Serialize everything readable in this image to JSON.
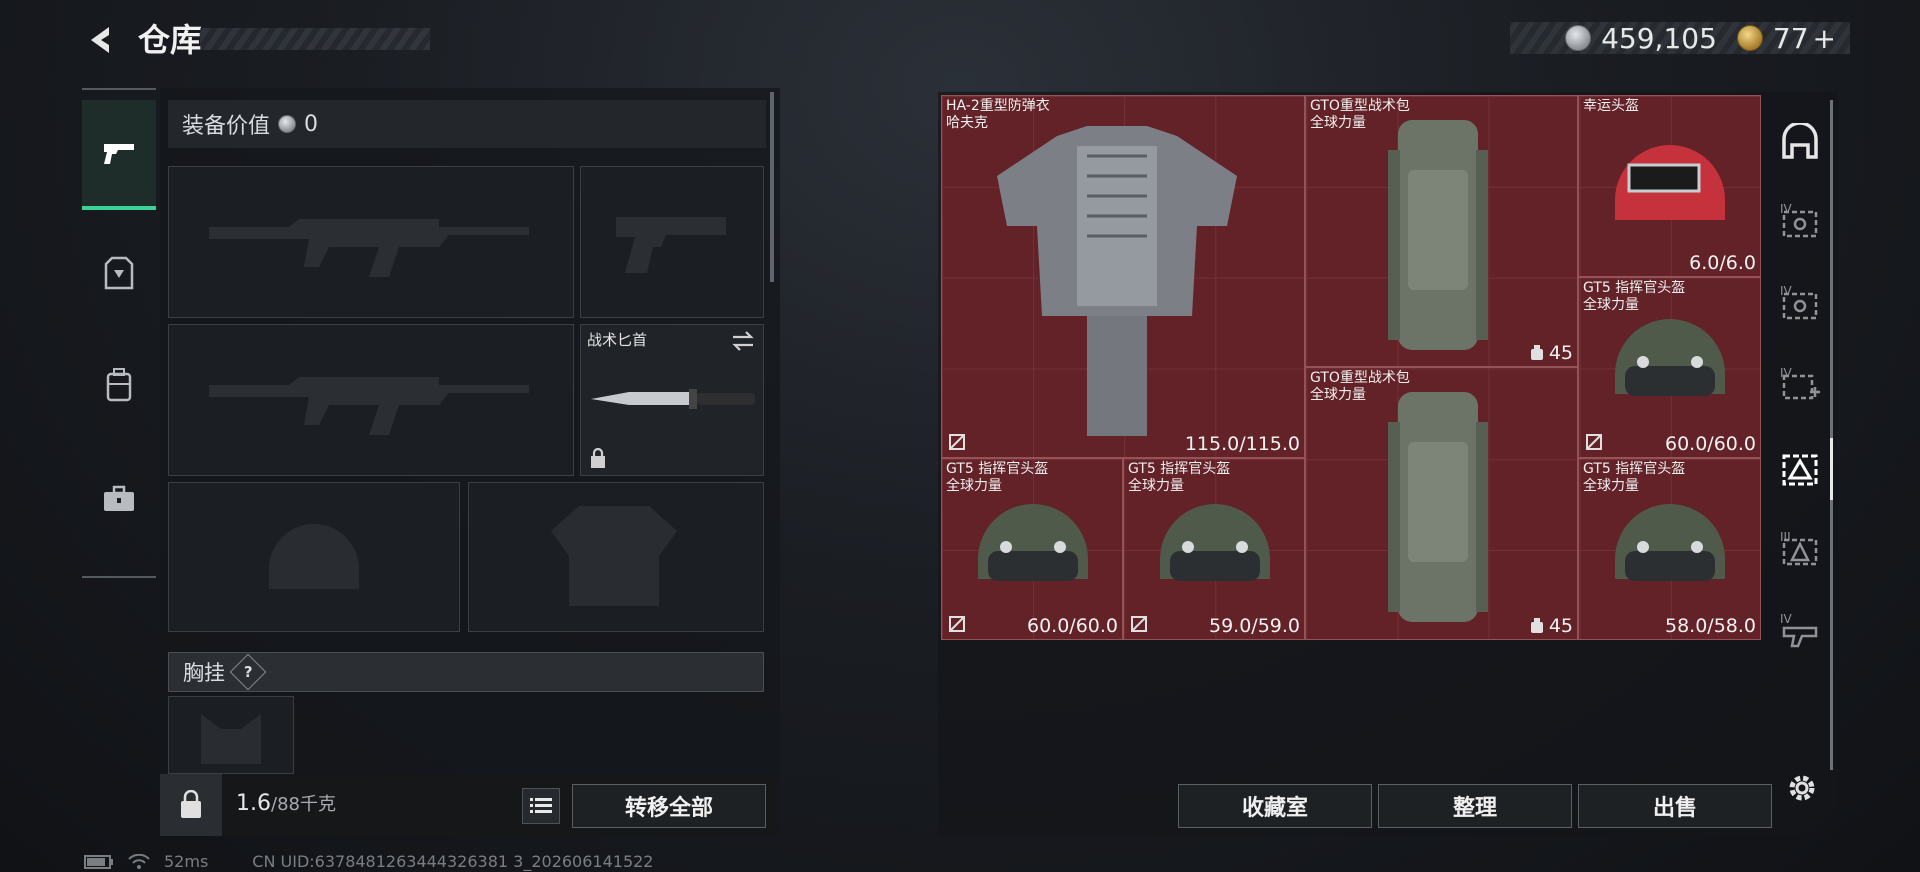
{
  "header": {
    "title": "仓库",
    "back_icon": "back-arrow-icon"
  },
  "currency": {
    "silver_amount": "459,105",
    "gold_amount": "77",
    "gold_plus": "+"
  },
  "rail": {
    "items": [
      "pistol-icon",
      "vest-icon",
      "backpack-icon",
      "case-icon"
    ],
    "active_index": 0
  },
  "loadout": {
    "equipment_value_label": "装备价值",
    "equipment_value": "0",
    "slots": {
      "knife_label": "战术匕首"
    },
    "chest_rig_label": "胸挂",
    "help_label": "?",
    "weight_current": "1.6",
    "weight_capacity": "/88千克",
    "transfer_all": "转移全部"
  },
  "storage": {
    "items": [
      {
        "name": "HA-2重型防弹衣",
        "sub": "哈夫克",
        "durability": "115.0/115.0",
        "insured_icon": true
      },
      {
        "name": "GTO重型战术包",
        "sub": "全球力量",
        "capacity": "45"
      },
      {
        "name": "幸运头盔",
        "sub": "",
        "durability": "6.0/6.0"
      },
      {
        "name": "GT5 指挥官头盔",
        "sub": "全球力量",
        "durability": "60.0/60.0",
        "insured_icon": true
      },
      {
        "name": "GTO重型战术包",
        "sub": "全球力量",
        "capacity": "45"
      },
      {
        "name": "GT5 指挥官头盔",
        "sub": "全球力量",
        "durability": "60.0/60.0",
        "insured_icon": true
      },
      {
        "name": "GT5 指挥官头盔",
        "sub": "全球力量",
        "durability": "59.0/59.0",
        "insured_icon": true
      },
      {
        "name": "GT5 指挥官头盔",
        "sub": "全球力量",
        "durability": "58.0/58.0",
        "insured_icon": false
      }
    ],
    "buttons": {
      "collection": "收藏室",
      "organize": "整理",
      "sell": "出售"
    }
  },
  "right_tabs": {
    "tier_label": "IV",
    "tier3_label": "III"
  },
  "status_bar": {
    "ping": "52ms",
    "uid": "CN UID:6378481263444326381 3_202606141522"
  },
  "colors": {
    "accent": "#3fd19a",
    "grid_red": "#5a1f24"
  }
}
